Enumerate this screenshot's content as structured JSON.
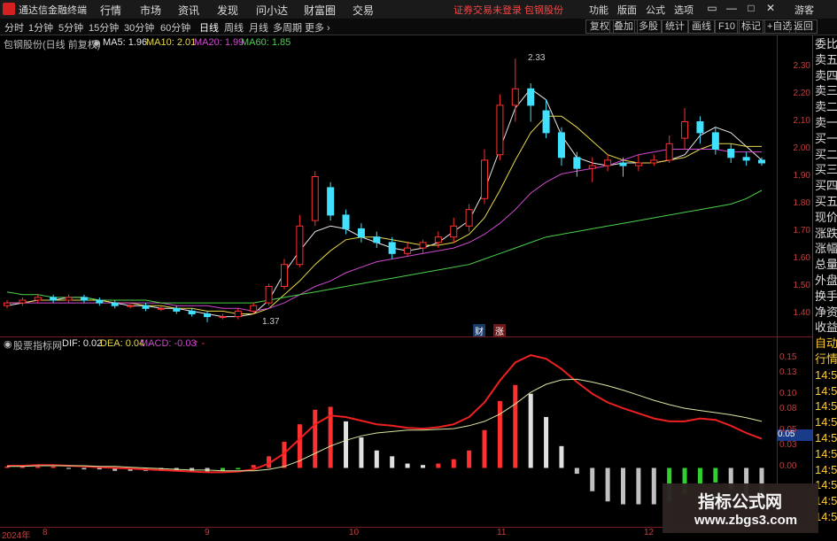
{
  "app": {
    "name": "通达信金融终端",
    "menu": [
      "行情",
      "市场",
      "资讯",
      "发现",
      "问小达",
      "财富圈",
      "交易"
    ],
    "notice": "证券交易未登录  包钢股份",
    "right_menu": [
      "功能",
      "版面",
      "公式",
      "选项"
    ],
    "window_controls": [
      "▭",
      "—",
      "□",
      "✕"
    ],
    "guest": "游客"
  },
  "toolbar": {
    "periods": [
      "分时",
      "1分钟",
      "5分钟",
      "15分钟",
      "30分钟",
      "60分钟",
      "日线",
      "周线",
      "月线",
      "多周期",
      "更多 ›"
    ],
    "active_period": "日线",
    "buttons": [
      "复权",
      "叠加",
      "多股",
      "统计",
      "画线",
      "F10",
      "标记",
      "+自选",
      "返回"
    ]
  },
  "main_chart": {
    "stock_title": "包钢股份(日线 前复权)",
    "ma": [
      {
        "label": "MA5: 1.96",
        "color": "#e8e8e8"
      },
      {
        "label": "MA10: 2.01",
        "color": "#e8d84a"
      },
      {
        "label": "MA20: 1.99",
        "color": "#d04ad0"
      },
      {
        "label": "MA60: 1.85",
        "color": "#4ad04a"
      }
    ],
    "high_label": "2.33",
    "low_label": "1.37",
    "badges": [
      "财",
      "涨"
    ],
    "y_ticks": [
      "2.30",
      "2.20",
      "2.10",
      "2.00",
      "1.90",
      "1.80",
      "1.70",
      "1.60",
      "1.50",
      "1.40"
    ]
  },
  "sub_chart": {
    "indicator_title": "股票指标网",
    "dif": "DIF: 0.02",
    "dea": "DEA: 0.04",
    "macd": "MACD: -0.03",
    "arrow": "↑ -",
    "y_ticks": [
      "0.15",
      "0.13",
      "0.10",
      "0.08",
      "0.05",
      "0.03",
      "0.00"
    ],
    "current_value": "0.05"
  },
  "side_panel": {
    "items": [
      "委比",
      "卖五",
      "卖四",
      "卖三",
      "卖二",
      "卖一",
      "买一",
      "买二",
      "买三",
      "买四",
      "买五",
      "现价",
      "涨跌",
      "涨幅",
      "总量",
      "外盘",
      "换手",
      "净资",
      "收益",
      "自动",
      "行情",
      "14:5",
      "14:5",
      "14:5",
      "14:5",
      "14:5",
      "14:5",
      "14:5",
      "14:5",
      "14:5",
      "14:5"
    ]
  },
  "x_axis": {
    "labels": [
      "2024年",
      "8",
      "9",
      "10",
      "11",
      "12"
    ]
  },
  "watermark": {
    "title": "指标公式网",
    "url": "www.zbgs3.com"
  },
  "colors": {
    "up": "#ff3030",
    "down": "#40e0ff",
    "ma5": "#e8e8e8",
    "ma10": "#e8d84a",
    "ma20": "#d04ad0",
    "ma60": "#4ad04a"
  },
  "chart_data": [
    {
      "type": "candlestick",
      "title": "包钢股份(日线 前复权)",
      "ylim": [
        1.35,
        2.35
      ],
      "series": [
        {
          "name": "MA5",
          "values": [
            1.43,
            1.44,
            1.45,
            1.45,
            1.46,
            1.46,
            1.45,
            1.44,
            1.43,
            1.43,
            1.42,
            1.42,
            1.41,
            1.4,
            1.39,
            1.39,
            1.4,
            1.45,
            1.55,
            1.63,
            1.7,
            1.72,
            1.71,
            1.68,
            1.66,
            1.64,
            1.63,
            1.64,
            1.66,
            1.7,
            1.74,
            1.85,
            2.0,
            2.15,
            2.22,
            2.18,
            2.05,
            1.97,
            1.95,
            1.94,
            1.95,
            1.95,
            1.95,
            1.96,
            1.98,
            2.05,
            2.08,
            2.06,
            2.01,
            1.96
          ]
        },
        {
          "name": "MA10",
          "values": [
            1.44,
            1.44,
            1.45,
            1.45,
            1.45,
            1.45,
            1.45,
            1.44,
            1.44,
            1.43,
            1.43,
            1.42,
            1.42,
            1.41,
            1.41,
            1.4,
            1.4,
            1.42,
            1.47,
            1.52,
            1.58,
            1.63,
            1.67,
            1.68,
            1.68,
            1.67,
            1.66,
            1.65,
            1.65,
            1.66,
            1.69,
            1.75,
            1.85,
            1.96,
            2.06,
            2.12,
            2.12,
            2.08,
            2.03,
            1.98,
            1.96,
            1.95,
            1.95,
            1.96,
            1.97,
            2.0,
            2.02,
            2.02,
            2.01,
            2.01
          ]
        },
        {
          "name": "MA20",
          "values": [
            1.44,
            1.44,
            1.44,
            1.44,
            1.44,
            1.44,
            1.44,
            1.44,
            1.44,
            1.44,
            1.44,
            1.43,
            1.43,
            1.43,
            1.42,
            1.42,
            1.41,
            1.42,
            1.44,
            1.47,
            1.5,
            1.52,
            1.55,
            1.57,
            1.59,
            1.6,
            1.61,
            1.62,
            1.63,
            1.64,
            1.66,
            1.69,
            1.73,
            1.78,
            1.84,
            1.88,
            1.91,
            1.92,
            1.93,
            1.94,
            1.96,
            1.98,
            1.99,
            2.0,
            2.0,
            2.0,
            2.0,
            1.99,
            1.99,
            1.99
          ]
        },
        {
          "name": "MA60",
          "values": [
            1.48,
            1.47,
            1.47,
            1.46,
            1.46,
            1.46,
            1.45,
            1.45,
            1.45,
            1.45,
            1.44,
            1.44,
            1.44,
            1.44,
            1.44,
            1.44,
            1.44,
            1.45,
            1.46,
            1.47,
            1.48,
            1.49,
            1.5,
            1.51,
            1.52,
            1.53,
            1.54,
            1.55,
            1.56,
            1.57,
            1.58,
            1.6,
            1.62,
            1.64,
            1.66,
            1.68,
            1.69,
            1.7,
            1.71,
            1.72,
            1.73,
            1.74,
            1.75,
            1.76,
            1.77,
            1.78,
            1.79,
            1.8,
            1.82,
            1.85
          ]
        }
      ],
      "candles": [
        [
          1.43,
          1.44,
          1.42,
          1.45
        ],
        [
          1.44,
          1.45,
          1.43,
          1.46
        ],
        [
          1.45,
          1.46,
          1.44,
          1.47
        ],
        [
          1.46,
          1.45,
          1.44,
          1.47
        ],
        [
          1.45,
          1.46,
          1.44,
          1.47
        ],
        [
          1.46,
          1.45,
          1.44,
          1.47
        ],
        [
          1.45,
          1.44,
          1.43,
          1.46
        ],
        [
          1.44,
          1.43,
          1.42,
          1.45
        ],
        [
          1.43,
          1.43,
          1.42,
          1.44
        ],
        [
          1.43,
          1.42,
          1.41,
          1.44
        ],
        [
          1.42,
          1.42,
          1.41,
          1.43
        ],
        [
          1.42,
          1.41,
          1.4,
          1.43
        ],
        [
          1.41,
          1.4,
          1.39,
          1.42
        ],
        [
          1.4,
          1.39,
          1.37,
          1.41
        ],
        [
          1.39,
          1.39,
          1.38,
          1.4
        ],
        [
          1.39,
          1.41,
          1.38,
          1.42
        ],
        [
          1.41,
          1.43,
          1.4,
          1.44
        ],
        [
          1.44,
          1.5,
          1.43,
          1.51
        ],
        [
          1.5,
          1.58,
          1.49,
          1.6
        ],
        [
          1.58,
          1.72,
          1.57,
          1.76
        ],
        [
          1.74,
          1.9,
          1.72,
          1.92
        ],
        [
          1.86,
          1.76,
          1.74,
          1.88
        ],
        [
          1.76,
          1.71,
          1.69,
          1.78
        ],
        [
          1.71,
          1.68,
          1.66,
          1.73
        ],
        [
          1.68,
          1.66,
          1.64,
          1.7
        ],
        [
          1.66,
          1.62,
          1.6,
          1.68
        ],
        [
          1.62,
          1.64,
          1.61,
          1.66
        ],
        [
          1.64,
          1.66,
          1.62,
          1.67
        ],
        [
          1.66,
          1.68,
          1.64,
          1.7
        ],
        [
          1.68,
          1.72,
          1.66,
          1.75
        ],
        [
          1.72,
          1.78,
          1.7,
          1.8
        ],
        [
          1.82,
          1.96,
          1.8,
          2.0
        ],
        [
          1.98,
          2.16,
          1.96,
          2.2
        ],
        [
          2.16,
          2.22,
          2.1,
          2.33
        ],
        [
          2.22,
          2.16,
          2.1,
          2.24
        ],
        [
          2.14,
          2.06,
          2.04,
          2.18
        ],
        [
          2.06,
          1.97,
          1.94,
          2.08
        ],
        [
          1.97,
          1.93,
          1.9,
          1.99
        ],
        [
          1.93,
          1.94,
          1.88,
          1.97
        ],
        [
          1.94,
          1.96,
          1.92,
          1.98
        ],
        [
          1.95,
          1.94,
          1.9,
          1.97
        ],
        [
          1.94,
          1.95,
          1.92,
          1.98
        ],
        [
          1.95,
          1.96,
          1.94,
          1.98
        ],
        [
          1.96,
          2.02,
          1.95,
          2.05
        ],
        [
          2.04,
          2.1,
          2.0,
          2.15
        ],
        [
          2.1,
          2.06,
          2.02,
          2.12
        ],
        [
          2.06,
          2.0,
          1.98,
          2.08
        ],
        [
          2.0,
          1.97,
          1.95,
          2.02
        ],
        [
          1.97,
          1.96,
          1.94,
          1.99
        ],
        [
          1.96,
          1.95,
          1.94,
          1.97
        ]
      ]
    },
    {
      "type": "bar",
      "title": "MACD",
      "ylim": [
        -0.07,
        0.16
      ],
      "series": [
        {
          "name": "DIF",
          "values": [
            0.003,
            0.003,
            0.004,
            0.004,
            0.003,
            0.002,
            0.001,
            0.0,
            -0.001,
            -0.002,
            -0.003,
            -0.004,
            -0.005,
            -0.006,
            -0.006,
            -0.005,
            -0.002,
            0.006,
            0.02,
            0.04,
            0.06,
            0.072,
            0.07,
            0.065,
            0.06,
            0.058,
            0.055,
            0.054,
            0.056,
            0.06,
            0.07,
            0.09,
            0.12,
            0.145,
            0.155,
            0.15,
            0.136,
            0.118,
            0.102,
            0.09,
            0.082,
            0.075,
            0.068,
            0.064,
            0.064,
            0.068,
            0.066,
            0.058,
            0.048,
            0.04
          ]
        },
        {
          "name": "DEA",
          "values": [
            0.002,
            0.002,
            0.003,
            0.003,
            0.003,
            0.003,
            0.002,
            0.002,
            0.001,
            0.0,
            -0.001,
            -0.002,
            -0.003,
            -0.003,
            -0.004,
            -0.004,
            -0.004,
            -0.002,
            0.002,
            0.01,
            0.02,
            0.03,
            0.038,
            0.044,
            0.048,
            0.05,
            0.052,
            0.052,
            0.053,
            0.054,
            0.058,
            0.064,
            0.074,
            0.088,
            0.104,
            0.115,
            0.121,
            0.122,
            0.118,
            0.113,
            0.107,
            0.1,
            0.093,
            0.087,
            0.082,
            0.079,
            0.076,
            0.073,
            0.069,
            0.064
          ]
        },
        {
          "name": "MACD",
          "values": [
            0.002,
            0.002,
            0.002,
            0.002,
            0.0,
            -0.002,
            -0.002,
            -0.004,
            -0.004,
            -0.004,
            -0.004,
            -0.004,
            -0.004,
            -0.006,
            -0.004,
            -0.002,
            0.004,
            0.016,
            0.036,
            0.06,
            0.08,
            0.084,
            0.064,
            0.042,
            0.024,
            0.016,
            0.006,
            0.004,
            0.006,
            0.012,
            0.024,
            0.052,
            0.092,
            0.114,
            0.102,
            0.07,
            0.03,
            -0.008,
            -0.032,
            -0.046,
            -0.05,
            -0.05,
            -0.05,
            -0.046,
            -0.036,
            -0.022,
            -0.02,
            -0.03,
            -0.042,
            -0.048
          ]
        }
      ]
    }
  ]
}
